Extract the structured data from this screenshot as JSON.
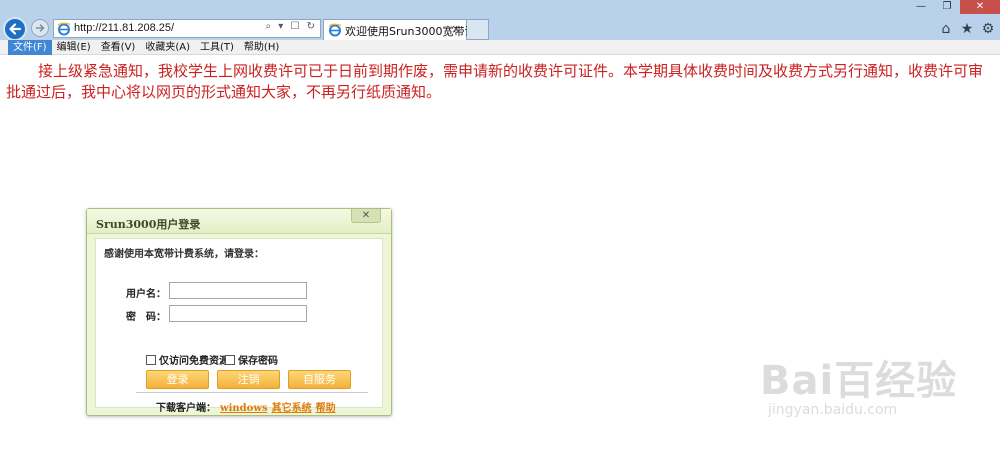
{
  "browser": {
    "window_controls": [
      "—",
      "❐",
      "✕"
    ],
    "address": {
      "url": "http://211.81.208.25/",
      "tools": "⌕ ▾ ☐ ↻"
    },
    "tab": {
      "title": "欢迎使用Srun3000宽带计...",
      "close": "×"
    },
    "right_icons": [
      "⌂",
      "★",
      "⚙"
    ],
    "menu": [
      "文件(F)",
      "编辑(E)",
      "查看(V)",
      "收藏夹(A)",
      "工具(T)",
      "帮助(H)"
    ]
  },
  "notice": "接上级紧急通知，我校学生上网收费许可已于日前到期作废，需申请新的收费许可证件。本学期具体收费时间及收费方式另行通知，收费许可审批通过后，我中心将以网页的形式通知大家，不再另行纸质通知。",
  "login": {
    "title": "Srun3000用户登录",
    "close": "✕",
    "greeting": "感谢使用本宽带计费系统，请登录：",
    "username_label": "用户名：",
    "username_value": "",
    "password_label": "密　码：",
    "password_value": "",
    "free_only_label": "仅访问免费资源",
    "save_password_label": "保存密码",
    "buttons": {
      "login": "登录",
      "logout": "注销",
      "selfservice": "自服务"
    },
    "download": {
      "label": "下载客户端：",
      "windows": "windows",
      "other": "其它系统",
      "help": "帮助"
    }
  },
  "watermark": {
    "brand": "Bai百经验",
    "site": "jingyan.baidu.com"
  }
}
